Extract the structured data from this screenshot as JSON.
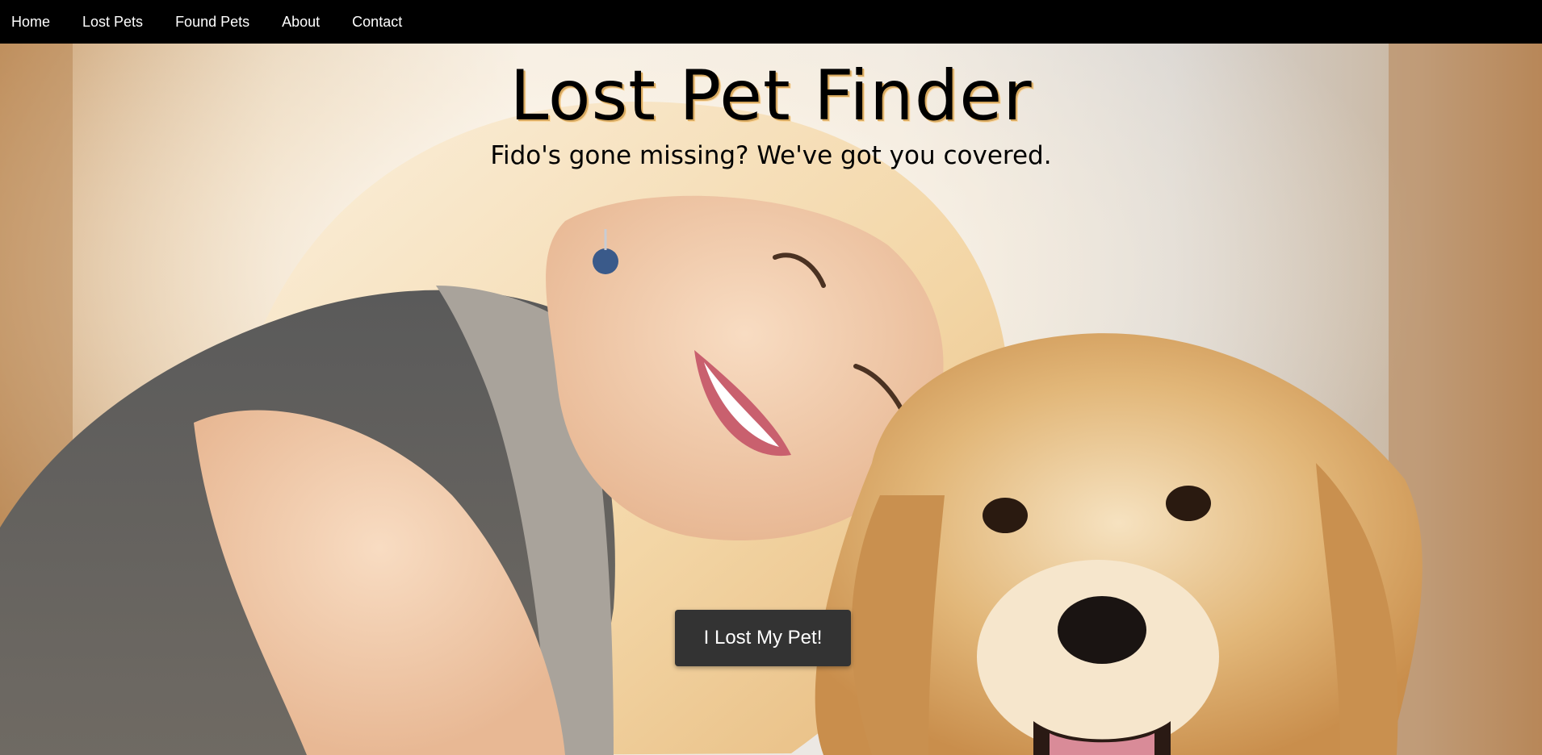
{
  "nav": {
    "items": [
      {
        "label": "Home"
      },
      {
        "label": "Lost Pets"
      },
      {
        "label": "Found Pets"
      },
      {
        "label": "About"
      },
      {
        "label": "Contact"
      }
    ]
  },
  "hero": {
    "title": "Lost Pet Finder",
    "subtitle": "Fido's gone missing? We've got you covered.",
    "button_label": "I Lost My Pet!",
    "photo_subject": "smiling blonde woman hugging golden retriever"
  },
  "colors": {
    "navbar_bg": "#000000",
    "nav_text": "#ffffff",
    "button_bg": "#333333",
    "button_text": "#ffffff",
    "title_text": "#000000",
    "title_glow": "#d6a85f"
  }
}
